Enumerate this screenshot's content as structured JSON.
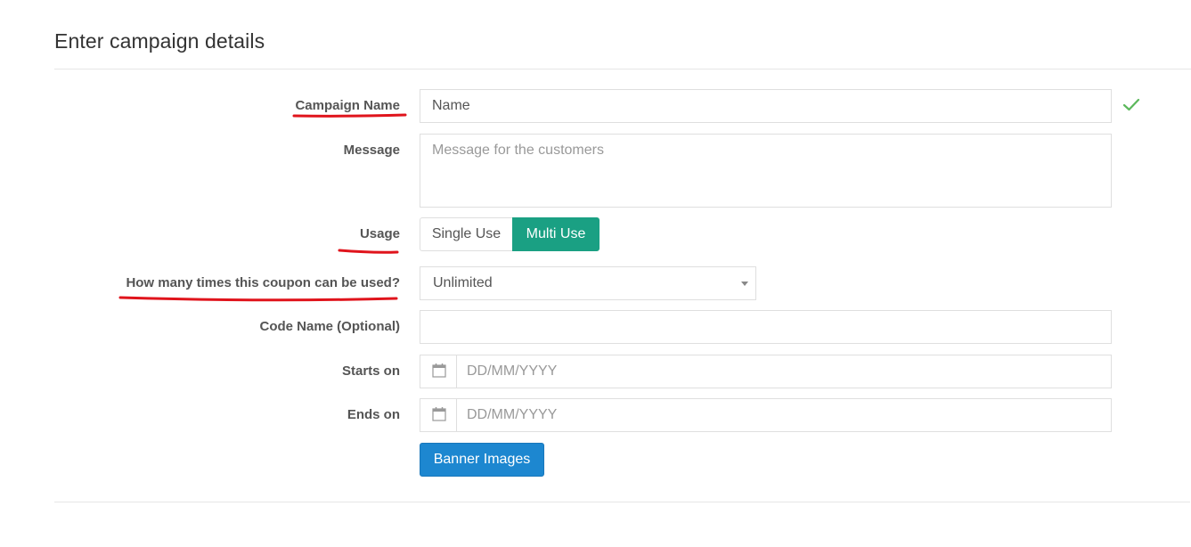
{
  "panel": {
    "title": "Enter campaign details"
  },
  "form": {
    "campaign_name": {
      "label": "Campaign Name",
      "value": "Name",
      "valid_icon": "check-icon",
      "valid_color": "#5cb85c"
    },
    "message": {
      "label": "Message",
      "placeholder": "Message for the customers"
    },
    "usage": {
      "label": "Usage",
      "options": [
        "Single Use",
        "Multi Use"
      ],
      "selected": "Multi Use",
      "selected_color": "#1aa083"
    },
    "times": {
      "label": "How many times this coupon can be used?",
      "selected": "Unlimited",
      "icon": "caret-down-icon"
    },
    "code_name": {
      "label": "Code Name (Optional)",
      "value": ""
    },
    "starts_on": {
      "label": "Starts on",
      "placeholder": "DD/MM/YYYY",
      "icon": "calendar-icon"
    },
    "ends_on": {
      "label": "Ends on",
      "placeholder": "DD/MM/YYYY",
      "icon": "calendar-icon"
    },
    "banner_button": {
      "label": "Banner Images",
      "color": "#1d87d0"
    }
  },
  "annotations": {
    "underline_color": "#e0141c"
  }
}
